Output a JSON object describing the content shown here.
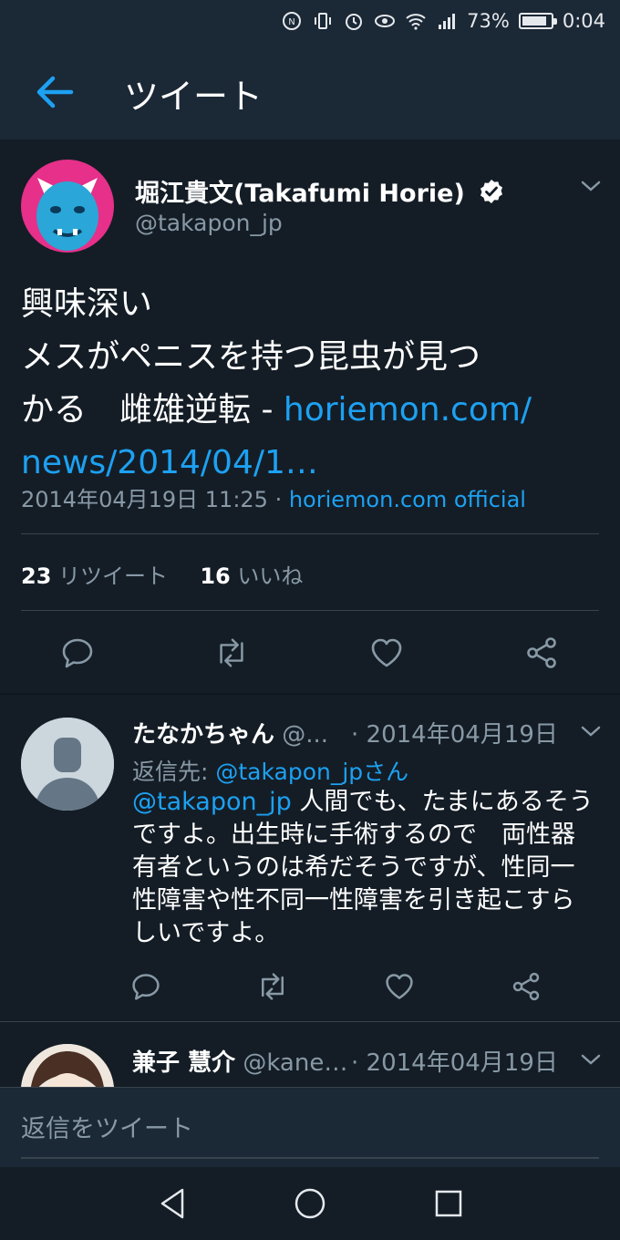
{
  "status_bar": {
    "battery": "73%",
    "time": "0:04",
    "icons": [
      "nfc-icon",
      "vibrate-icon",
      "alarm-icon",
      "eye-icon",
      "wifi-icon",
      "signal-icon",
      "battery-icon"
    ]
  },
  "header": {
    "title": "ツイート",
    "back_icon": "arrow-left-icon"
  },
  "tweet": {
    "author_name": "堀江貴文(Takafumi Horie)",
    "handle": "@takapon_jp",
    "lines": [
      "興味深い",
      "メスがペニスを持つ昆虫が見つ",
      "かる　雌雄逆転 - "
    ],
    "link_part1": "horiemon.com/",
    "link_part2": "news/2014/04/1…",
    "timestamp": "2014年04月19日 11:25 · ",
    "source": "horiemon.com official",
    "retweets_count": "23",
    "retweets_label": "リツイート",
    "likes_count": "16",
    "likes_label": "いいね"
  },
  "replies": [
    {
      "name": "たなかちゃん",
      "handle": "@...",
      "date": "· 2014年04月19日",
      "reply_to_prefix": "返信先: ",
      "reply_to_handle": "@takapon_jpさん",
      "mention": "@takapon_jp",
      "text_first": " 人間でも、たまにあるそう",
      "text_lines": [
        "ですよ。出生時に手術するので　両性器",
        "有者というのは希だそうですが、性同一",
        "性障害や性不同一性障害を引き起こすら",
        "しいですよ。"
      ]
    },
    {
      "name": "兼子 慧介",
      "handle": "@kane…",
      "date": "· 2014年04月19日"
    }
  ],
  "reply_bar": {
    "placeholder": "返信をツイート"
  },
  "colors": {
    "background": "#141d26",
    "header_bg": "#1b2836",
    "accent": "#1da1f2",
    "secondary_text": "#8899a6"
  }
}
